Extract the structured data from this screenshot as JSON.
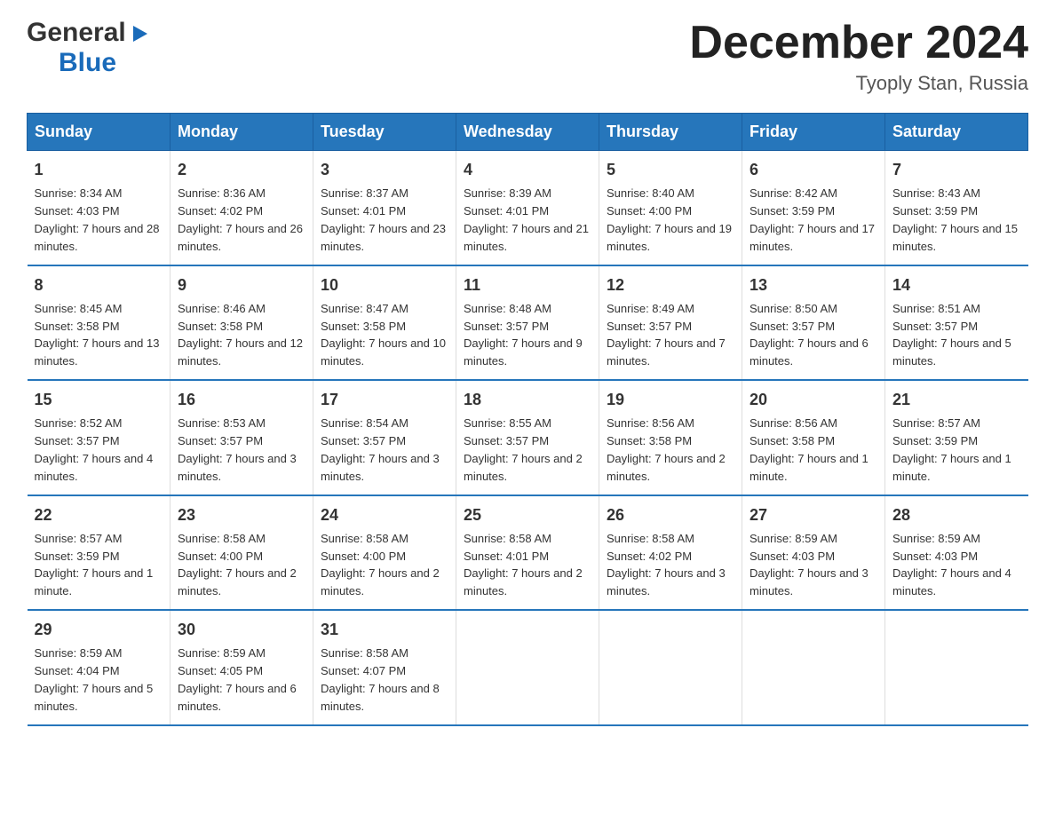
{
  "logo": {
    "general": "General",
    "blue": "Blue",
    "arrow": true
  },
  "title": "December 2024",
  "subtitle": "Tyoply Stan, Russia",
  "days_header": [
    "Sunday",
    "Monday",
    "Tuesday",
    "Wednesday",
    "Thursday",
    "Friday",
    "Saturday"
  ],
  "weeks": [
    [
      {
        "num": "1",
        "sunrise": "8:34 AM",
        "sunset": "4:03 PM",
        "daylight": "7 hours and 28 minutes."
      },
      {
        "num": "2",
        "sunrise": "8:36 AM",
        "sunset": "4:02 PM",
        "daylight": "7 hours and 26 minutes."
      },
      {
        "num": "3",
        "sunrise": "8:37 AM",
        "sunset": "4:01 PM",
        "daylight": "7 hours and 23 minutes."
      },
      {
        "num": "4",
        "sunrise": "8:39 AM",
        "sunset": "4:01 PM",
        "daylight": "7 hours and 21 minutes."
      },
      {
        "num": "5",
        "sunrise": "8:40 AM",
        "sunset": "4:00 PM",
        "daylight": "7 hours and 19 minutes."
      },
      {
        "num": "6",
        "sunrise": "8:42 AM",
        "sunset": "3:59 PM",
        "daylight": "7 hours and 17 minutes."
      },
      {
        "num": "7",
        "sunrise": "8:43 AM",
        "sunset": "3:59 PM",
        "daylight": "7 hours and 15 minutes."
      }
    ],
    [
      {
        "num": "8",
        "sunrise": "8:45 AM",
        "sunset": "3:58 PM",
        "daylight": "7 hours and 13 minutes."
      },
      {
        "num": "9",
        "sunrise": "8:46 AM",
        "sunset": "3:58 PM",
        "daylight": "7 hours and 12 minutes."
      },
      {
        "num": "10",
        "sunrise": "8:47 AM",
        "sunset": "3:58 PM",
        "daylight": "7 hours and 10 minutes."
      },
      {
        "num": "11",
        "sunrise": "8:48 AM",
        "sunset": "3:57 PM",
        "daylight": "7 hours and 9 minutes."
      },
      {
        "num": "12",
        "sunrise": "8:49 AM",
        "sunset": "3:57 PM",
        "daylight": "7 hours and 7 minutes."
      },
      {
        "num": "13",
        "sunrise": "8:50 AM",
        "sunset": "3:57 PM",
        "daylight": "7 hours and 6 minutes."
      },
      {
        "num": "14",
        "sunrise": "8:51 AM",
        "sunset": "3:57 PM",
        "daylight": "7 hours and 5 minutes."
      }
    ],
    [
      {
        "num": "15",
        "sunrise": "8:52 AM",
        "sunset": "3:57 PM",
        "daylight": "7 hours and 4 minutes."
      },
      {
        "num": "16",
        "sunrise": "8:53 AM",
        "sunset": "3:57 PM",
        "daylight": "7 hours and 3 minutes."
      },
      {
        "num": "17",
        "sunrise": "8:54 AM",
        "sunset": "3:57 PM",
        "daylight": "7 hours and 3 minutes."
      },
      {
        "num": "18",
        "sunrise": "8:55 AM",
        "sunset": "3:57 PM",
        "daylight": "7 hours and 2 minutes."
      },
      {
        "num": "19",
        "sunrise": "8:56 AM",
        "sunset": "3:58 PM",
        "daylight": "7 hours and 2 minutes."
      },
      {
        "num": "20",
        "sunrise": "8:56 AM",
        "sunset": "3:58 PM",
        "daylight": "7 hours and 1 minute."
      },
      {
        "num": "21",
        "sunrise": "8:57 AM",
        "sunset": "3:59 PM",
        "daylight": "7 hours and 1 minute."
      }
    ],
    [
      {
        "num": "22",
        "sunrise": "8:57 AM",
        "sunset": "3:59 PM",
        "daylight": "7 hours and 1 minute."
      },
      {
        "num": "23",
        "sunrise": "8:58 AM",
        "sunset": "4:00 PM",
        "daylight": "7 hours and 2 minutes."
      },
      {
        "num": "24",
        "sunrise": "8:58 AM",
        "sunset": "4:00 PM",
        "daylight": "7 hours and 2 minutes."
      },
      {
        "num": "25",
        "sunrise": "8:58 AM",
        "sunset": "4:01 PM",
        "daylight": "7 hours and 2 minutes."
      },
      {
        "num": "26",
        "sunrise": "8:58 AM",
        "sunset": "4:02 PM",
        "daylight": "7 hours and 3 minutes."
      },
      {
        "num": "27",
        "sunrise": "8:59 AM",
        "sunset": "4:03 PM",
        "daylight": "7 hours and 3 minutes."
      },
      {
        "num": "28",
        "sunrise": "8:59 AM",
        "sunset": "4:03 PM",
        "daylight": "7 hours and 4 minutes."
      }
    ],
    [
      {
        "num": "29",
        "sunrise": "8:59 AM",
        "sunset": "4:04 PM",
        "daylight": "7 hours and 5 minutes."
      },
      {
        "num": "30",
        "sunrise": "8:59 AM",
        "sunset": "4:05 PM",
        "daylight": "7 hours and 6 minutes."
      },
      {
        "num": "31",
        "sunrise": "8:58 AM",
        "sunset": "4:07 PM",
        "daylight": "7 hours and 8 minutes."
      },
      {
        "num": "",
        "sunrise": "",
        "sunset": "",
        "daylight": ""
      },
      {
        "num": "",
        "sunrise": "",
        "sunset": "",
        "daylight": ""
      },
      {
        "num": "",
        "sunrise": "",
        "sunset": "",
        "daylight": ""
      },
      {
        "num": "",
        "sunrise": "",
        "sunset": "",
        "daylight": ""
      }
    ]
  ],
  "labels": {
    "sunrise": "Sunrise: ",
    "sunset": "Sunset: ",
    "daylight": "Daylight: "
  }
}
